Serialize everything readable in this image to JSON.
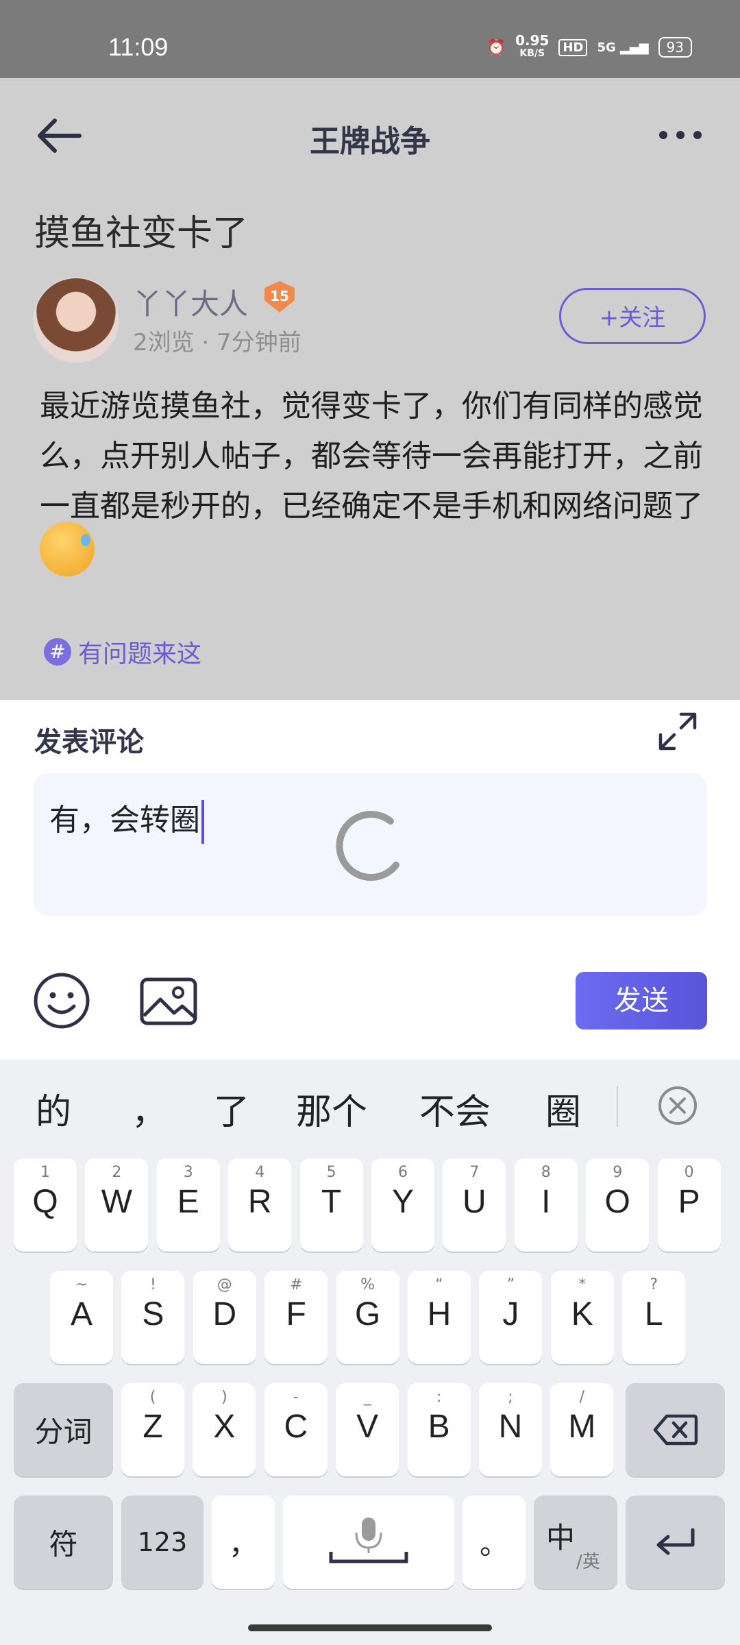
{
  "status_bar": {
    "time": "11:09",
    "net_speed": "0.95",
    "net_unit": "KB/S",
    "hd": "HD",
    "signal": "5G",
    "battery": "93"
  },
  "header": {
    "title": "王牌战争"
  },
  "post": {
    "title": "摸鱼社变卡了",
    "author": "丫丫大人",
    "level": "15",
    "meta": "2浏览 · 7分钟前",
    "follow_label": "+关注",
    "body": "最近游览摸鱼社，觉得变卡了，你们有同样的感觉么，点开别人帖子，都会等待一会再能打开，之前一直都是秒开的，已经确定不是手机和网络问题了",
    "topic": "有问题来这",
    "topic_symbol": "#"
  },
  "comment": {
    "title": "发表评论",
    "text": "有，会转圈",
    "send_label": "发送"
  },
  "keyboard": {
    "suggestions": [
      "的",
      "，",
      "了",
      "那个",
      "不会",
      "圈"
    ],
    "row1": [
      {
        "k": "Q",
        "h": "1"
      },
      {
        "k": "W",
        "h": "2"
      },
      {
        "k": "E",
        "h": "3"
      },
      {
        "k": "R",
        "h": "4"
      },
      {
        "k": "T",
        "h": "5"
      },
      {
        "k": "Y",
        "h": "6"
      },
      {
        "k": "U",
        "h": "7"
      },
      {
        "k": "I",
        "h": "8"
      },
      {
        "k": "O",
        "h": "9"
      },
      {
        "k": "P",
        "h": "0"
      }
    ],
    "row2": [
      {
        "k": "A",
        "h": "~"
      },
      {
        "k": "S",
        "h": "!"
      },
      {
        "k": "D",
        "h": "@"
      },
      {
        "k": "F",
        "h": "#"
      },
      {
        "k": "G",
        "h": "%"
      },
      {
        "k": "H",
        "h": "“"
      },
      {
        "k": "J",
        "h": "”"
      },
      {
        "k": "K",
        "h": "*"
      },
      {
        "k": "L",
        "h": "?"
      }
    ],
    "row3": [
      {
        "k": "Z",
        "h": "("
      },
      {
        "k": "X",
        "h": ")"
      },
      {
        "k": "C",
        "h": "-"
      },
      {
        "k": "V",
        "h": "_"
      },
      {
        "k": "B",
        "h": ":"
      },
      {
        "k": "N",
        "h": ";"
      },
      {
        "k": "M",
        "h": "/"
      }
    ],
    "fenci": "分词",
    "symbols": "符",
    "numbers": "123",
    "comma": "，",
    "period": "。",
    "lang_main": "中",
    "lang_sub": "/英"
  }
}
